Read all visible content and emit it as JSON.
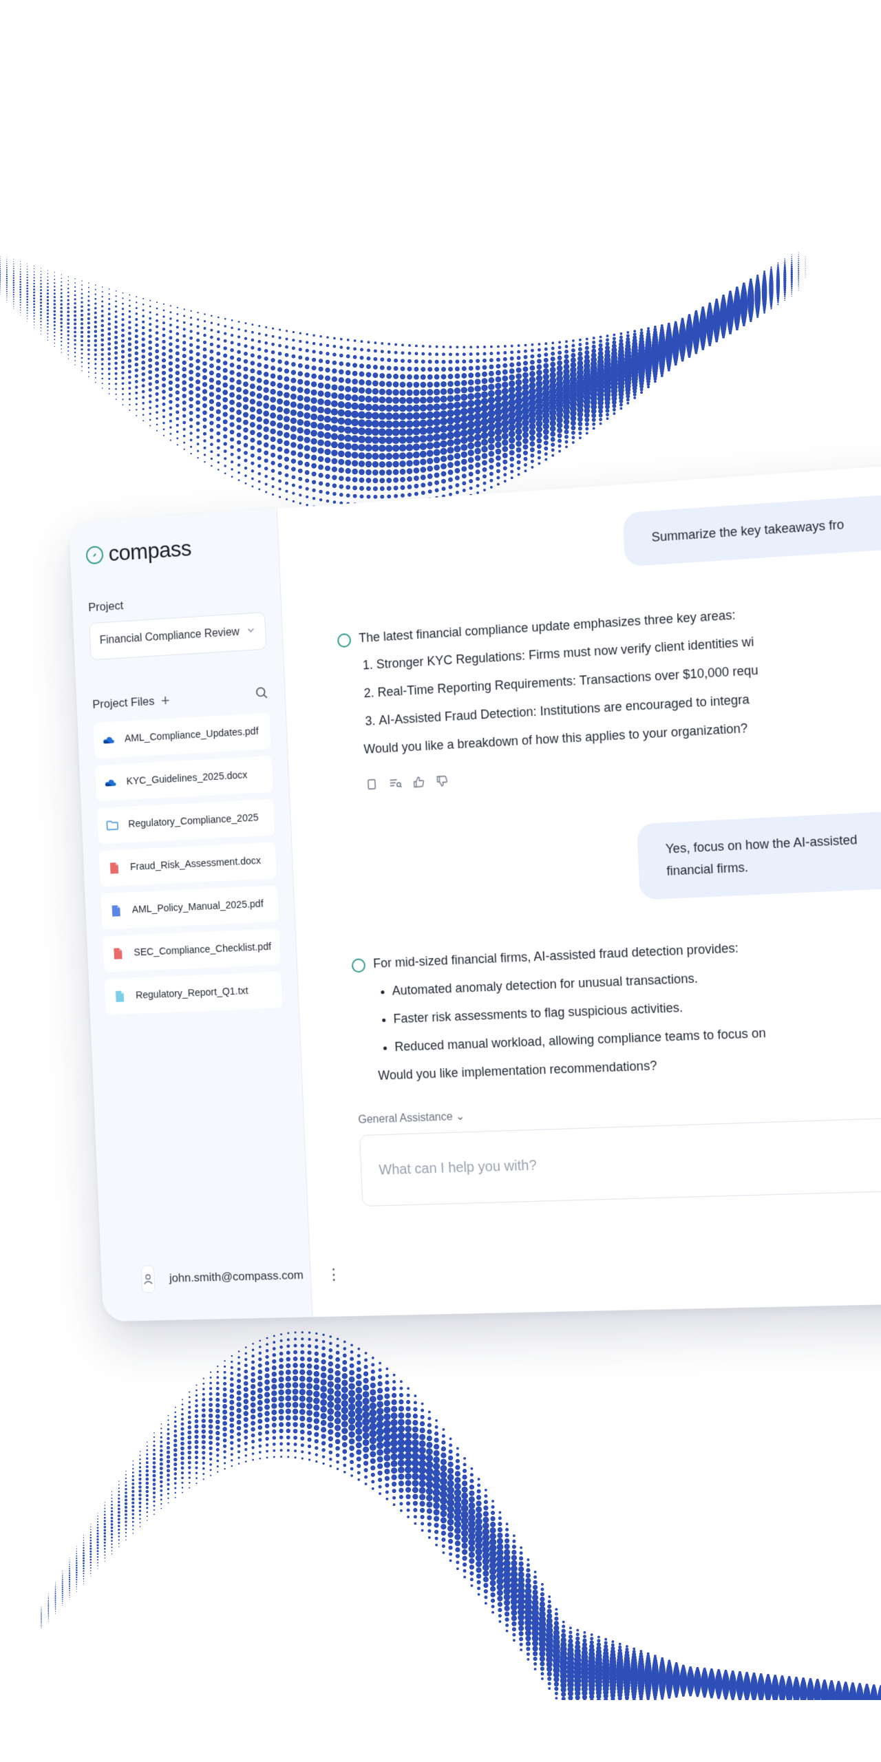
{
  "brand": {
    "name": "compass",
    "accent": "#2f9a8a",
    "wave_color": "#2f4fb8"
  },
  "sidebar": {
    "project_label": "Project",
    "project_value": "Financial Compliance Review",
    "files_label": "Project Files",
    "files": [
      {
        "name": "AML_Compliance_Updates.pdf",
        "icon": "onedrive-cloud-icon"
      },
      {
        "name": "KYC_Guidelines_2025.docx",
        "icon": "onedrive-cloud-icon"
      },
      {
        "name": "Regulatory_Compliance_2025",
        "icon": "folder-icon"
      },
      {
        "name": "Fraud_Risk_Assessment.docx",
        "icon": "red-file-icon"
      },
      {
        "name": "AML_Policy_Manual_2025.pdf",
        "icon": "blue-file-icon"
      },
      {
        "name": "SEC_Compliance_Checklist.pdf",
        "icon": "red-file-icon"
      },
      {
        "name": "Regulatory_Report_Q1.txt",
        "icon": "teal-file-icon"
      }
    ],
    "user_email": "john.smith@compass.com"
  },
  "chat": {
    "user_1": "Summarize the key takeaways fro",
    "assistant_1": {
      "intro": "The latest financial compliance update emphasizes three key areas:",
      "items": [
        "Stronger KYC Regulations: Firms must now verify client identities wi",
        "Real-Time Reporting Requirements: Transactions over $10,000 requ",
        "AI-Assisted Fraud Detection: Institutions are encouraged to integra"
      ],
      "outro": "Would you like a breakdown of how this applies to your organization?"
    },
    "user_2_line1": "Yes, focus on how the AI-assisted",
    "user_2_line2": "financial firms.",
    "assistant_2": {
      "intro": "For mid-sized financial firms, AI-assisted fraud detection provides:",
      "bullets": [
        "Automated anomaly detection for unusual transactions.",
        "Faster risk assessments to flag suspicious activities.",
        "Reduced manual workload, allowing compliance teams to focus on"
      ],
      "outro": "Would you like implementation recommendations?"
    }
  },
  "composer": {
    "mode_label": "General Assistance",
    "placeholder": "What can I help you with?"
  }
}
